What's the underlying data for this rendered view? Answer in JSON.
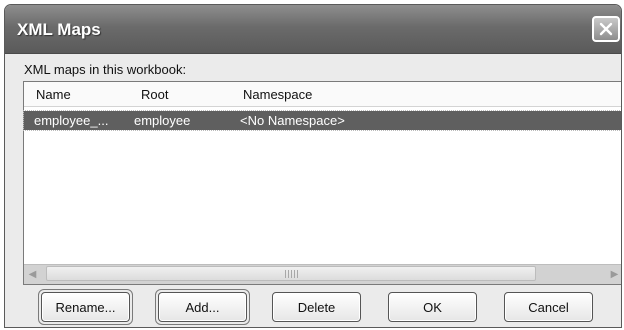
{
  "window": {
    "title": "XML Maps",
    "close_icon": "close-icon"
  },
  "label": {
    "text": "XML maps in this workbook:"
  },
  "list": {
    "columns": [
      "Name",
      "Root",
      "Namespace"
    ],
    "rows": [
      {
        "name": "employee_...",
        "root": "employee",
        "namespace": "<No Namespace>"
      }
    ],
    "selected_row_color": "#5f5f5f"
  },
  "buttons": {
    "rename": "Rename...",
    "add": "Add...",
    "delete": "Delete",
    "ok": "OK",
    "cancel": "Cancel"
  }
}
